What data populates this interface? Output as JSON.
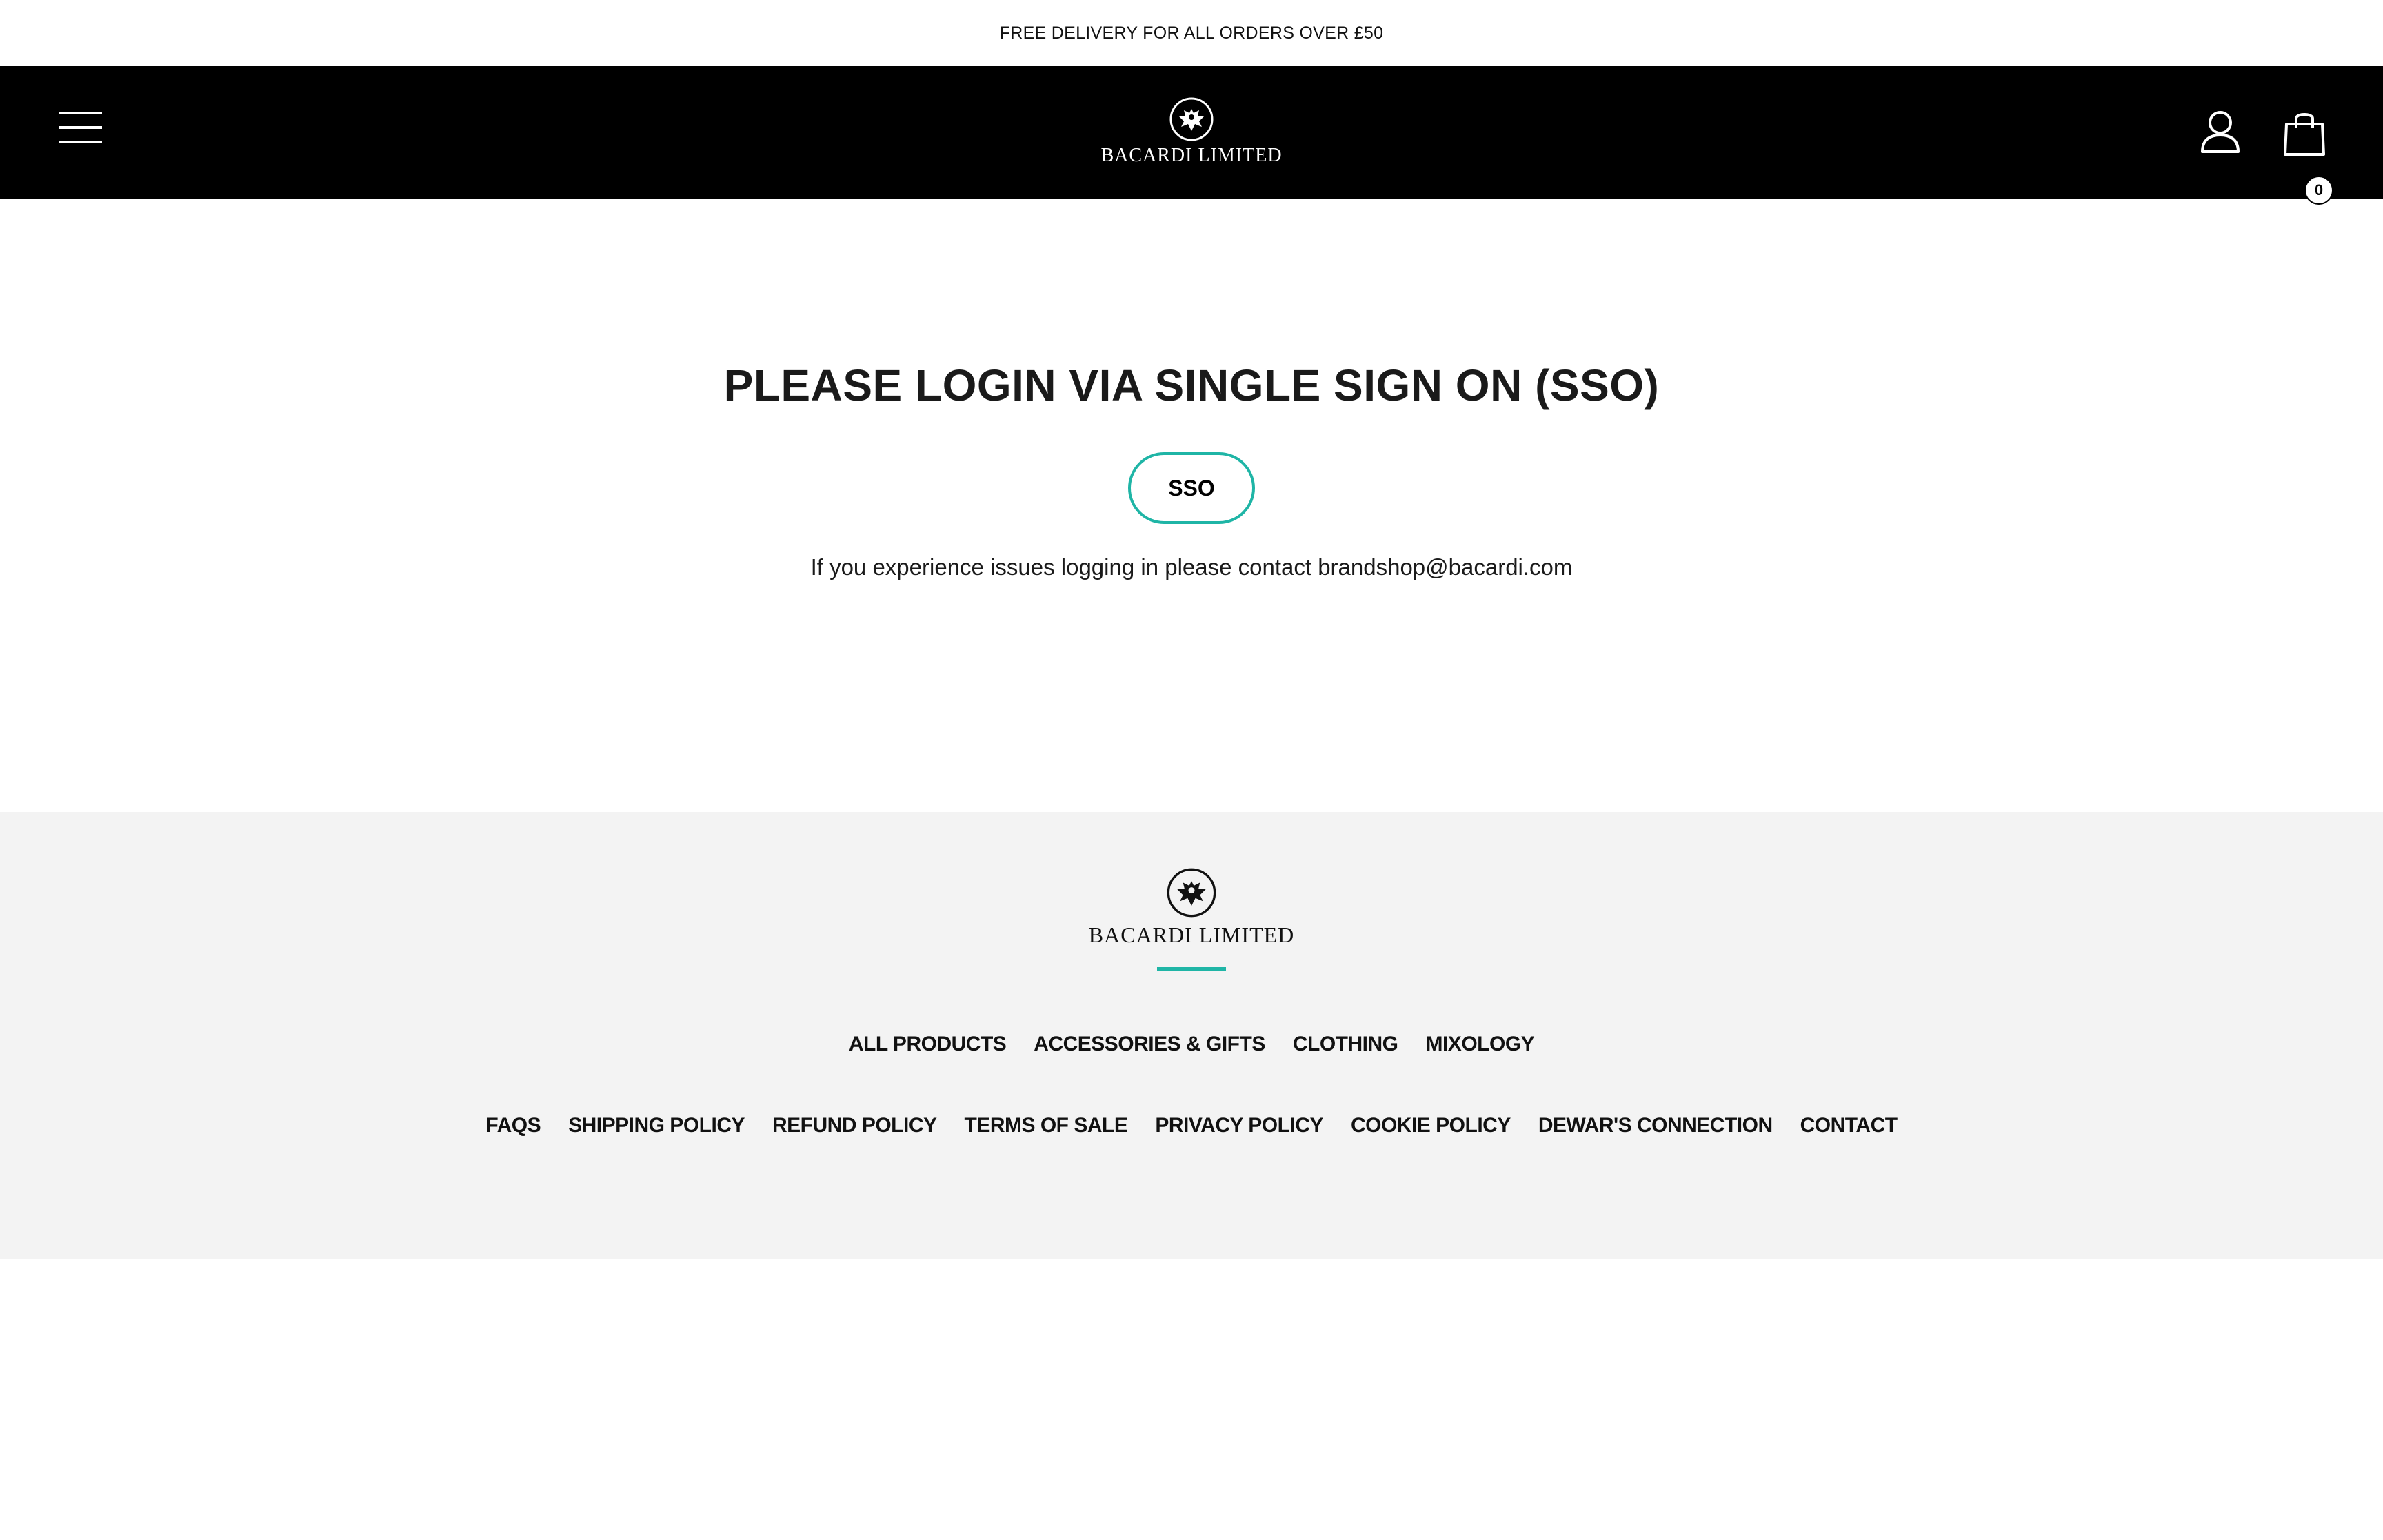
{
  "announcement": {
    "text": "FREE DELIVERY FOR ALL ORDERS OVER £50"
  },
  "header": {
    "logo_text": "BACARDI LIMITED",
    "menu_icon": "hamburger-menu-icon",
    "account_icon": "user-account-icon",
    "cart_icon": "shopping-bag-icon",
    "cart_count": "0"
  },
  "main": {
    "title": "PLEASE LOGIN VIA SINGLE SIGN ON (SSO)",
    "sso_button_label": "SSO",
    "help_text": "If you experience issues logging in please contact brandshop@bacardi.com"
  },
  "footer": {
    "logo_text": "BACARDI LIMITED",
    "primary_links": [
      "ALL PRODUCTS",
      "ACCESSORIES & GIFTS",
      "CLOTHING",
      "MIXOLOGY"
    ],
    "secondary_links": [
      "FAQS",
      "SHIPPING POLICY",
      "REFUND POLICY",
      "TERMS OF SALE",
      "PRIVACY POLICY",
      "COOKIE POLICY",
      "DEWAR'S CONNECTION",
      "CONTACT"
    ]
  },
  "colors": {
    "accent": "#1fb5a6",
    "header_bg": "#000000",
    "footer_bg": "#f3f3f3"
  }
}
